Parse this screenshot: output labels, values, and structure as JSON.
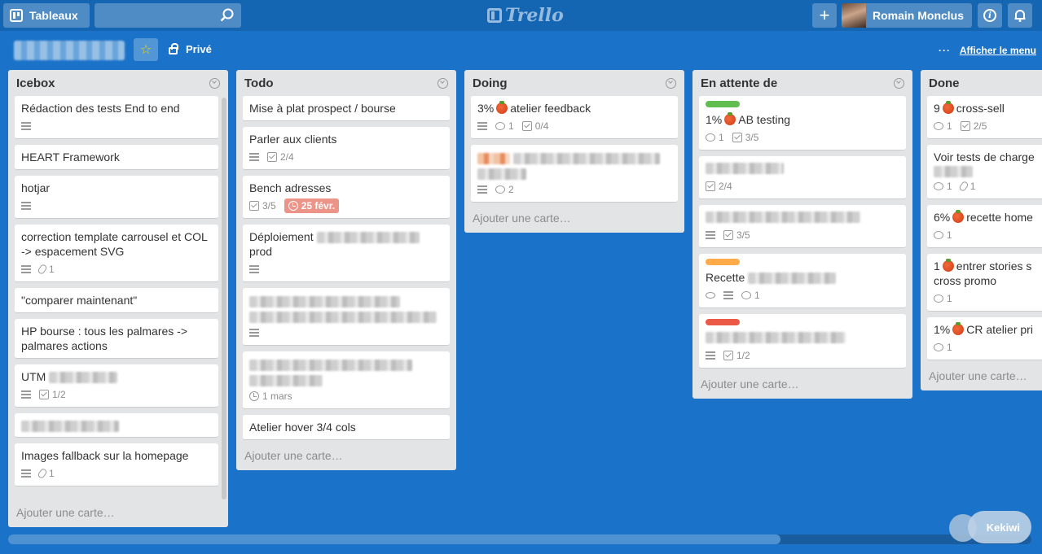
{
  "header": {
    "boards_label": "Tableaux",
    "search_value": "",
    "logo_text": "Trello",
    "add_symbol": "+",
    "user_name": "Romain Monclus",
    "info_symbol": "i"
  },
  "board": {
    "name": "",
    "visibility": "Privé",
    "show_menu_label": "Afficher le menu",
    "menu_dots": "···"
  },
  "lists": [
    {
      "title": "Icebox",
      "add_label": "Ajouter une carte…",
      "cards": [
        {
          "title": "Rédaction des tests End to end",
          "desc": true
        },
        {
          "title": "HEART Framework"
        },
        {
          "title": "hotjar",
          "desc": true
        },
        {
          "title": "correction template carrousel et COL -> espacement SVG",
          "desc": true,
          "attachments": "1"
        },
        {
          "title": "\"comparer maintenant\""
        },
        {
          "title": "HP bourse : tous les palmares -> palmares actions"
        },
        {
          "title": "UTM",
          "desc": true,
          "checklist": "1/2"
        },
        {
          "title": ""
        },
        {
          "title": "Images fallback sur la homepage",
          "desc": true,
          "attachments": "1"
        }
      ]
    },
    {
      "title": "Todo",
      "add_label": "Ajouter une carte…",
      "cards": [
        {
          "title": "Mise à plat prospect / bourse"
        },
        {
          "title": "Parler aux clients",
          "desc": true,
          "checklist": "2/4"
        },
        {
          "title": "Bench adresses",
          "checklist": "3/5",
          "due": "25 févr."
        },
        {
          "title": "Déploiement",
          "title2": "prod",
          "desc": true
        },
        {
          "title": "",
          "desc": true
        },
        {
          "title": "",
          "due_plain": "1 mars"
        },
        {
          "title": "Atelier hover 3/4 cols"
        }
      ]
    },
    {
      "title": "Doing",
      "add_label": "Ajouter une carte…",
      "cards": [
        {
          "pct": "3%",
          "title": "atelier feedback",
          "desc": true,
          "comments": "1",
          "checklist": "0/4"
        },
        {
          "title": "",
          "desc": true,
          "comments": "2"
        }
      ]
    },
    {
      "title": "En attente de",
      "add_label": "Ajouter une carte…",
      "cards": [
        {
          "label_color": "#61bd4f",
          "pct": "1%",
          "title": "AB testing",
          "comments": "1",
          "checklist": "3/5"
        },
        {
          "title": "",
          "checklist": "2/4"
        },
        {
          "title": "",
          "desc": true,
          "checklist": "3/5"
        },
        {
          "label_color": "#ffab4a",
          "title": "Recette",
          "desc": true,
          "comments": "1"
        },
        {
          "label_color": "#eb5a46",
          "title": "",
          "desc": true,
          "checklist": "1/2"
        }
      ]
    },
    {
      "title": "Done",
      "add_label": "Ajouter une carte…",
      "cards": [
        {
          "pct": "9",
          "title": "cross-sell",
          "comments": "1",
          "checklist": "2/5"
        },
        {
          "title": "Voir tests de charge",
          "comments": "1",
          "attachments": "1"
        },
        {
          "pct": "6%",
          "title": "recette home",
          "comments": "1"
        },
        {
          "pct": "1",
          "title": "entrer stories s",
          "title2": "cross promo",
          "comments": "1"
        },
        {
          "pct": "1%",
          "title": "CR atelier pri",
          "comments": "1"
        }
      ]
    }
  ],
  "widget": {
    "label": "Ke",
    "label2": "kiwi"
  },
  "colors": {
    "board_bg": "#1a73c8",
    "header_bg": "#1466b3",
    "list_bg": "#e2e4e6",
    "due_bg": "#ec9488",
    "star": "#f2d600"
  }
}
